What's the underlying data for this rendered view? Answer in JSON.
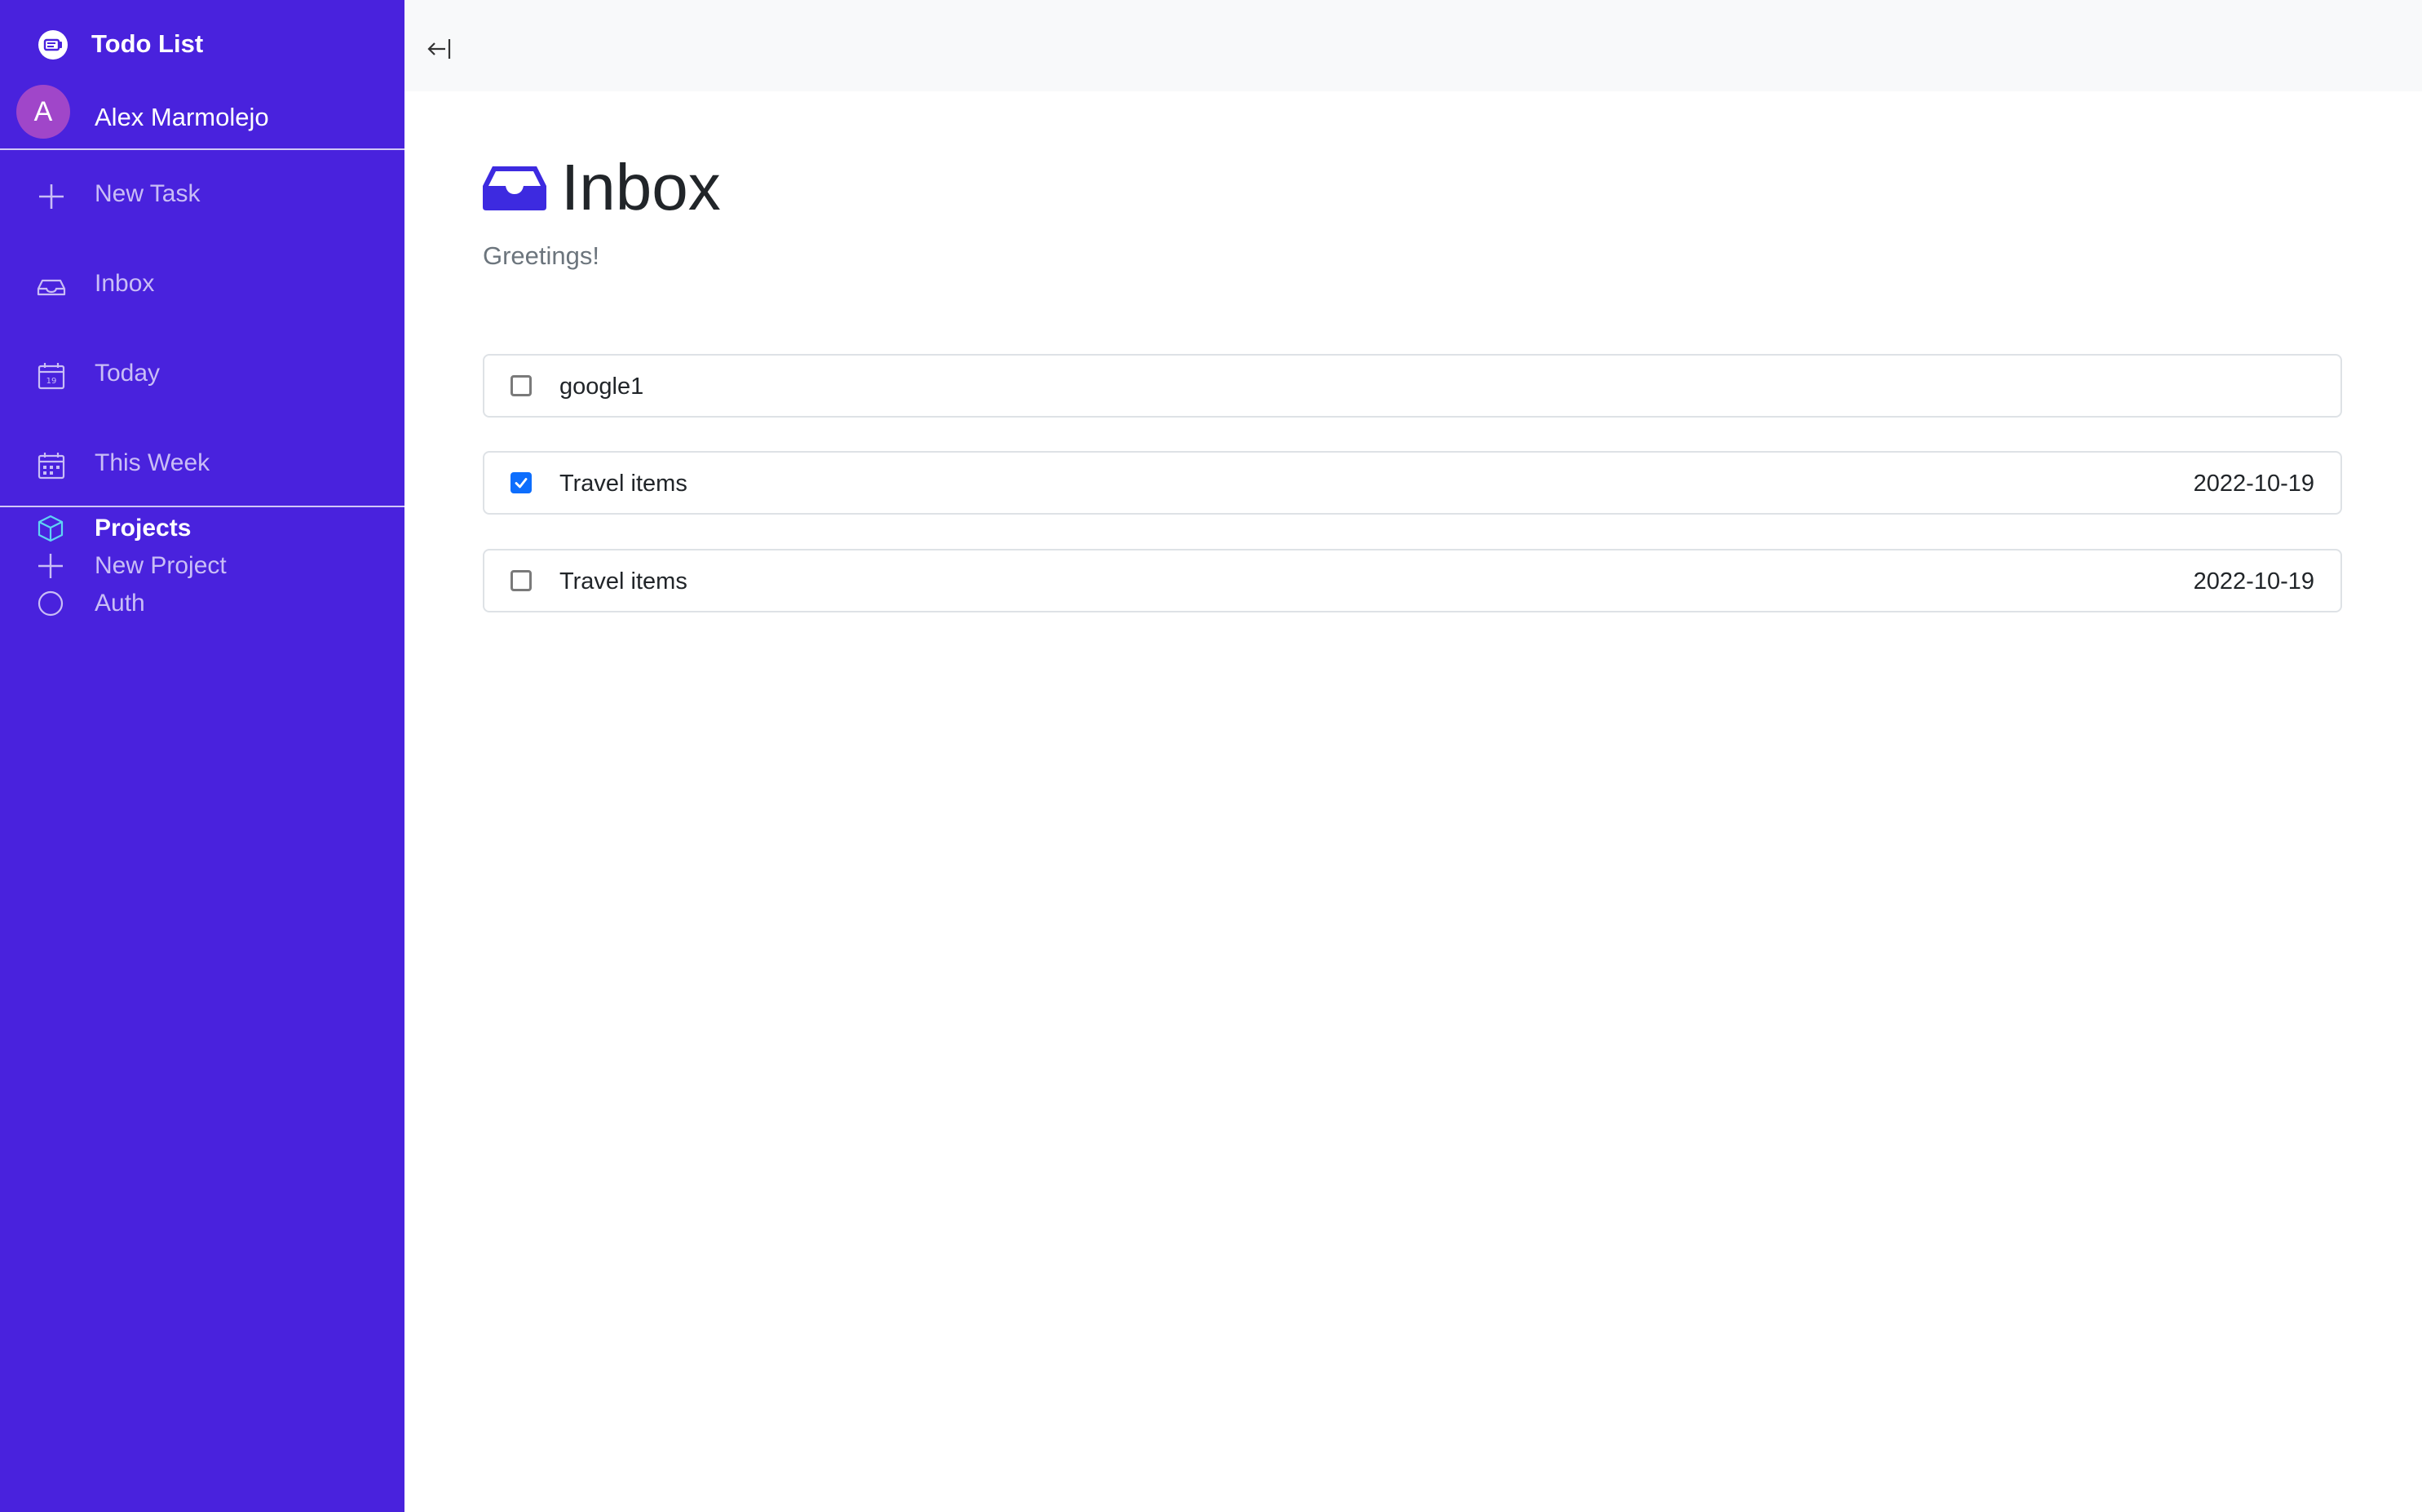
{
  "brand": {
    "title": "Todo List"
  },
  "user": {
    "initial": "A",
    "name": "Alex Marmolejo"
  },
  "nav": {
    "new_task": "New Task",
    "inbox": "Inbox",
    "today": "Today",
    "this_week": "This Week"
  },
  "projects": {
    "heading": "Projects",
    "new_project": "New Project",
    "items": [
      {
        "label": "Auth"
      }
    ]
  },
  "page": {
    "title": "Inbox",
    "subtitle": "Greetings!"
  },
  "tasks": [
    {
      "title": "google1",
      "date": "",
      "done": false
    },
    {
      "title": "Travel items",
      "date": "2022-10-19",
      "done": true
    },
    {
      "title": "Travel items",
      "date": "2022-10-19",
      "done": false
    }
  ],
  "colors": {
    "sidebar_bg": "#4922dd",
    "avatar_bg": "#a046c9",
    "accent": "#3d2ae0",
    "checkbox_checked": "#0d6efd",
    "topbar_bg": "#f8f9fa"
  },
  "icons": {
    "brand": "checklist-icon",
    "new_task": "plus-icon",
    "inbox": "inbox-icon",
    "today": "calendar-day-icon",
    "this_week": "calendar-week-icon",
    "projects": "box-icon",
    "new_project": "plus-icon",
    "project": "circle-icon",
    "collapse": "arrow-bar-left-icon",
    "page": "inbox-fill-icon"
  }
}
